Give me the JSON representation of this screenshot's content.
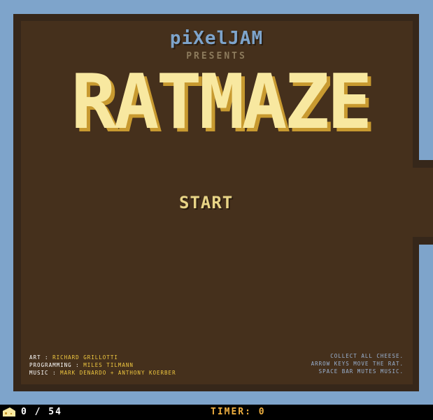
{
  "brand": "piXelJAM",
  "presents": "PRESENTS",
  "title": "RATMAZE",
  "start_label": "START",
  "credits": [
    {
      "role": "ART :",
      "name": "RICHARD GRILLOTTI"
    },
    {
      "role": "PROGRAMMING :",
      "name": "MILES TILMANN"
    },
    {
      "role": "MUSIC :",
      "name": "MARK DENARDO + ANTHONY KOERBER"
    }
  ],
  "instructions": [
    "COLLECT ALL CHEESE.",
    "ARROW KEYS MOVE THE RAT.",
    "SPACE BAR MUTES MUSIC."
  ],
  "status": {
    "cheese_count": "0 / 54",
    "timer": "TIMER: 0"
  },
  "colors": {
    "background_blue": "#7ea4cb",
    "board_brown": "#45301c",
    "cheese_yellow": "#f8e8a0",
    "timer_orange": "#f0b040"
  }
}
